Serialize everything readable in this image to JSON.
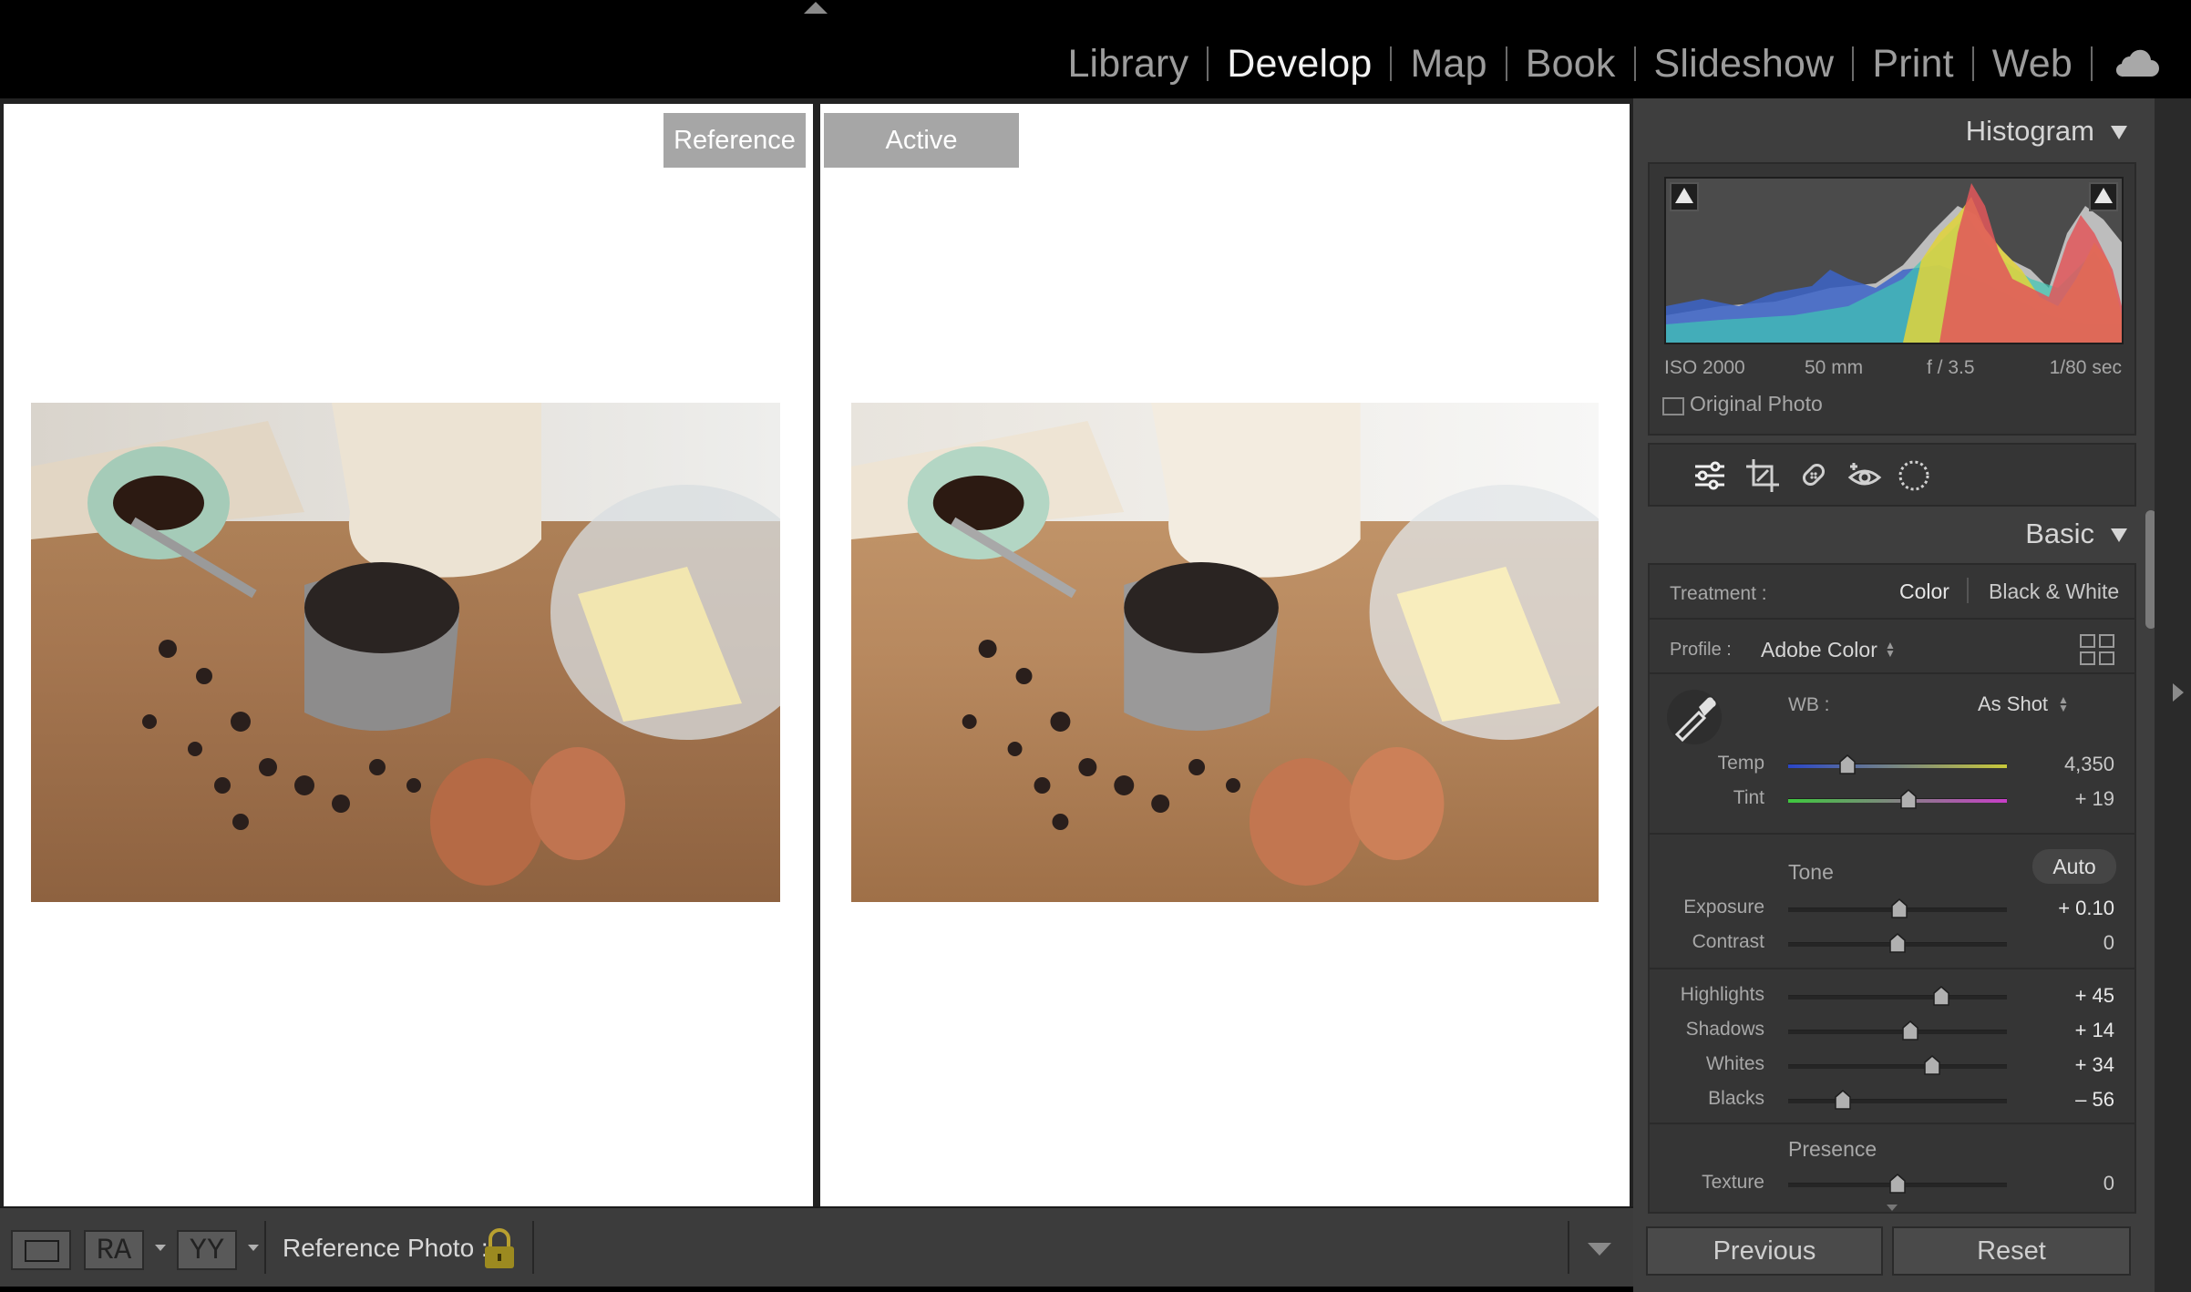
{
  "modules": [
    "Library",
    "Develop",
    "Map",
    "Book",
    "Slideshow",
    "Print",
    "Web"
  ],
  "active_module": "Develop",
  "compare": {
    "reference_label": "Reference",
    "active_label": "Active"
  },
  "toolbar": {
    "ra_label": "RA",
    "yy_label": "YY",
    "reference_photo_label": "Reference Photo :"
  },
  "histogram": {
    "title": "Histogram",
    "iso": "ISO 2000",
    "focal_length": "50 mm",
    "aperture": "f / 3.5",
    "shutter": "1/80 sec",
    "original_photo_label": "Original Photo",
    "original_photo_checked": false
  },
  "basic": {
    "title": "Basic",
    "treatment_label": "Treatment :",
    "treatment_color": "Color",
    "treatment_bw": "Black & White",
    "profile_label": "Profile :",
    "profile_value": "Adobe Color",
    "wb_label": "WB :",
    "wb_value": "As Shot",
    "tone_label": "Tone",
    "auto_label": "Auto",
    "presence_label": "Presence",
    "sliders": {
      "temp": {
        "label": "Temp",
        "value": "4,350",
        "level": 0.27
      },
      "tint": {
        "label": "Tint",
        "value": "+ 19",
        "level": 0.55
      },
      "exposure": {
        "label": "Exposure",
        "value": "+ 0.10",
        "level": 0.51
      },
      "contrast": {
        "label": "Contrast",
        "value": "0",
        "level": 0.5
      },
      "highlights": {
        "label": "Highlights",
        "value": "+ 45",
        "level": 0.7
      },
      "shadows": {
        "label": "Shadows",
        "value": "+ 14",
        "level": 0.56
      },
      "whites": {
        "label": "Whites",
        "value": "+ 34",
        "level": 0.66
      },
      "blacks": {
        "label": "Blacks",
        "value": "– 56",
        "level": 0.25
      },
      "texture": {
        "label": "Texture",
        "value": "0",
        "level": 0.5
      }
    }
  },
  "buttons": {
    "previous": "Previous",
    "reset": "Reset"
  },
  "colors": {
    "panel_bg": "#3e3e3e",
    "section_bg": "#353535",
    "label_bg": "#a6a6a6",
    "highlight_text": "#f2f2f2"
  }
}
